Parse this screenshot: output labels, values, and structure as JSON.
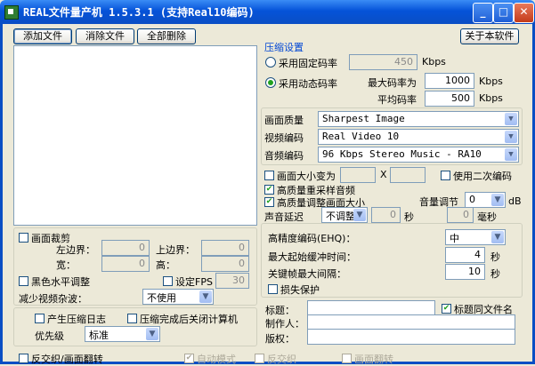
{
  "window": {
    "title": "REAL文件量产机 1.5.3.1 (支持Real10编码)",
    "min": "_",
    "max": "□",
    "close": "✕"
  },
  "toolbar": {
    "add": "添加文件",
    "remove": "消除文件",
    "remove_all": "全部删除",
    "about": "关于本软件"
  },
  "compress": {
    "title": "压缩设置",
    "fixed": "采用固定码率",
    "fixed_val": "450",
    "dynamic": "采用动态码率",
    "max_label": "最大码率为",
    "max_val": "1000",
    "avg_label": "平均码率",
    "avg_val": "500",
    "unit": "Kbps"
  },
  "codec": {
    "quality_label": "画面质量",
    "quality": "Sharpest Image",
    "video_label": "视频编码",
    "video": "Real Video 10",
    "audio_label": "音频编码",
    "audio": "96 Kbps Stereo Music - RA10"
  },
  "options": {
    "resize": "画面大小变为",
    "x": "X",
    "twopass": "使用二次编码",
    "hq_resample": "高质量重采样音频",
    "hq_resize": "高质量调整画面大小",
    "volume_label": "音量调节",
    "volume": "0",
    "db": "dB",
    "delay_label": "声音延迟",
    "delay_mode": "不调整",
    "delay_s": "0",
    "sec": "秒",
    "delay_ms": "0",
    "ms": "毫秒"
  },
  "crop": {
    "title": "画面裁剪",
    "left": "左边界：",
    "left_val": "0",
    "top": "上边界：",
    "top_val": "0",
    "width": "宽：",
    "width_val": "0",
    "height": "高：",
    "height_val": "0"
  },
  "fix": {
    "bw": "黑色水平调整",
    "fps": "设定FPS",
    "fps_val": "30",
    "noise": "减少视频杂波：",
    "noise_val": "不使用"
  },
  "ehq": {
    "label": "高精度编码(EHQ)：",
    "value": "中",
    "buffer_label": "最大起始缓冲时间：",
    "buffer_val": "4",
    "keyframe_label": "关键帧最大间隔：",
    "keyframe_val": "10",
    "sec": "秒",
    "loss": "损失保护"
  },
  "log": {
    "gen": "产生压缩日志",
    "shutdown": "压缩完成后关闭计算机",
    "priority_label": "优先级",
    "priority": "标准"
  },
  "meta": {
    "title_label": "标题：",
    "same_name": "标题同文件名",
    "author_label": "制作人：",
    "copyright_label": "版权："
  },
  "bottom": {
    "deinterlace": "反交织/画面翻转",
    "auto": "自动模式",
    "deint": "反交织",
    "flip": "画面翻转"
  }
}
